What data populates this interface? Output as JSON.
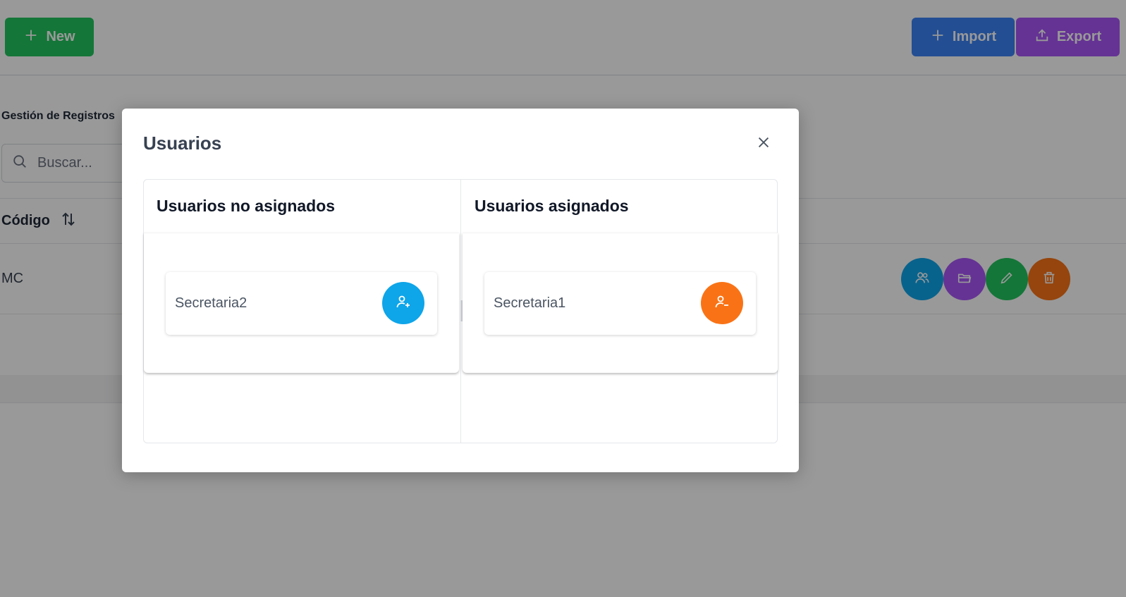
{
  "toolbar": {
    "new_label": "New",
    "import_label": "Import",
    "export_label": "Export"
  },
  "section": {
    "title": "Gestión de Registros"
  },
  "search": {
    "placeholder": "Buscar..."
  },
  "table": {
    "columns": [
      "Código"
    ],
    "rows": [
      {
        "code": "MC"
      }
    ]
  },
  "modal": {
    "title": "Usuarios",
    "unassigned_title": "Usuarios no asignados",
    "assigned_title": "Usuarios asignados",
    "unassigned_users": [
      "Secretaria2"
    ],
    "assigned_users": [
      "Secretaria1"
    ]
  },
  "colors": {
    "new": "#22c55e",
    "import": "#3b82f6",
    "export": "#a855f7",
    "assign": "#0ea5e9",
    "unassign": "#f97316"
  },
  "icons": {
    "new": "plus-icon",
    "import": "plus-icon",
    "export": "upload-icon",
    "search": "search-icon",
    "sort": "sort-icon",
    "close": "close-icon",
    "row_users": "users-icon",
    "row_folder": "folder-icon",
    "row_edit": "pencil-icon",
    "row_delete": "trash-icon",
    "assign": "user-plus-icon",
    "unassign": "user-minus-icon"
  }
}
